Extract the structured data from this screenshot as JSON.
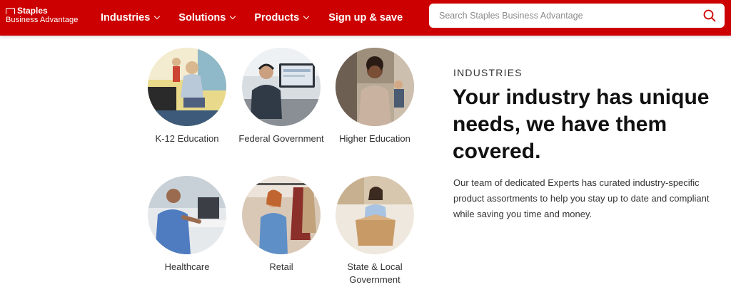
{
  "header": {
    "logo_line1": "Staples",
    "logo_line2": "Business Advantage",
    "nav": [
      {
        "label": "Industries"
      },
      {
        "label": "Solutions"
      },
      {
        "label": "Products"
      }
    ],
    "signup_label": "Sign up & save",
    "search_placeholder": "Search Staples Business Advantage",
    "brand_color": "#cc0000"
  },
  "industries": [
    {
      "label": "K-12 Education"
    },
    {
      "label": "Federal Government"
    },
    {
      "label": "Higher Education"
    },
    {
      "label": "Healthcare"
    },
    {
      "label": "Retail"
    },
    {
      "label": "State & Local Government"
    }
  ],
  "content": {
    "eyebrow": "INDUSTRIES",
    "headline": "Your industry has unique needs, we have them covered.",
    "body": "Our team of dedicated Experts has curated industry-specific product assortments to help you stay up to date and compliant while saving you time and money."
  }
}
